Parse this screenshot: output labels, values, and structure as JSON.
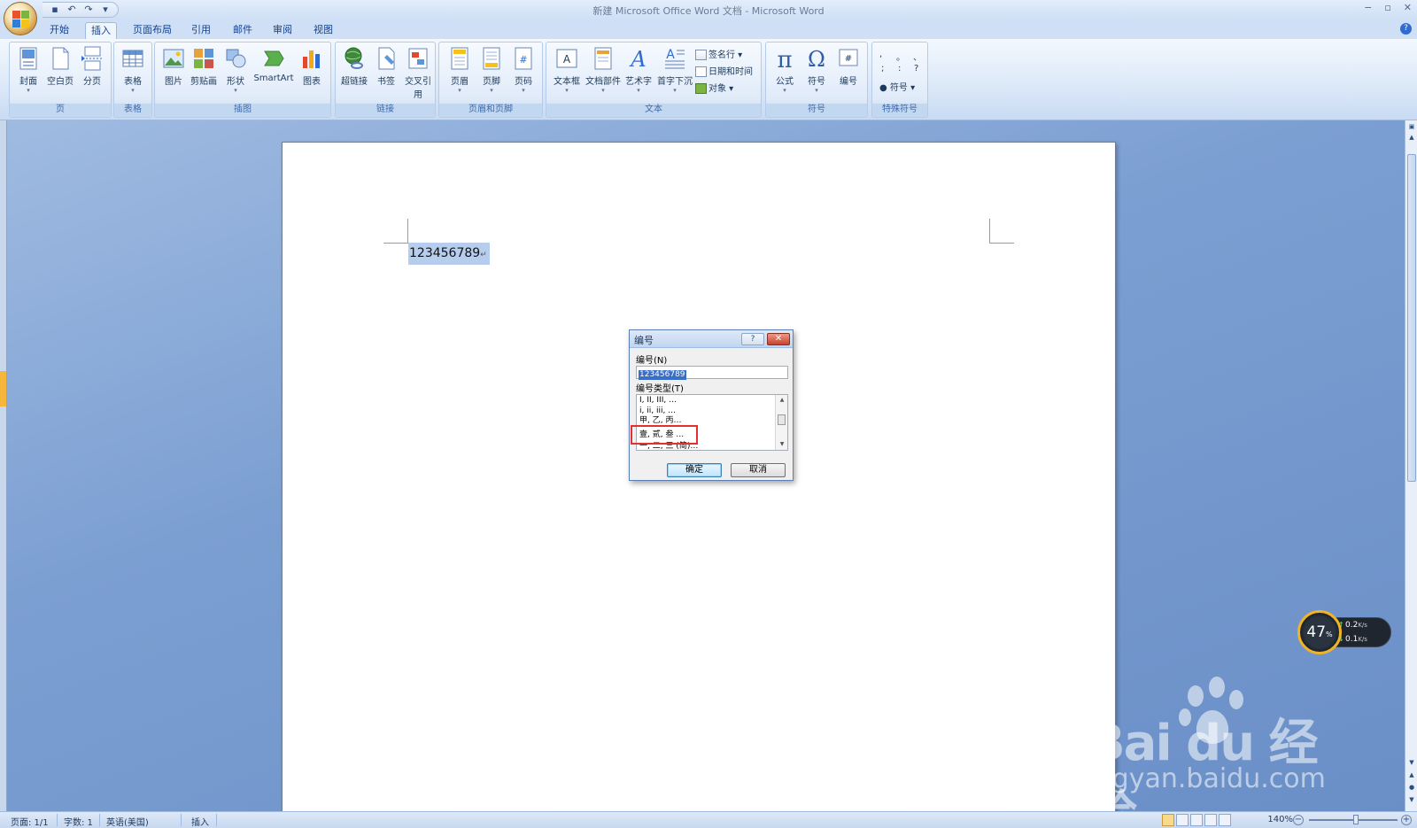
{
  "window": {
    "title": "新建 Microsoft Office Word 文档 - Microsoft Word",
    "controls": [
      "−",
      "▫",
      "✕"
    ]
  },
  "qat": {
    "save_icon": "save-icon",
    "undo_icon": "undo-icon",
    "redo_icon": "redo-icon"
  },
  "tabs": [
    "开始",
    "插入",
    "页面布局",
    "引用",
    "邮件",
    "审阅",
    "视图"
  ],
  "active_tab": "插入",
  "ribbon": {
    "groups": {
      "page": {
        "label": "页",
        "buttons": [
          "封面",
          "空白页",
          "分页"
        ]
      },
      "table": {
        "label": "表格",
        "buttons": [
          "表格"
        ]
      },
      "illustrations": {
        "label": "插图",
        "buttons": [
          "图片",
          "剪贴画",
          "形状",
          "SmartArt",
          "图表"
        ]
      },
      "links": {
        "label": "链接",
        "buttons": [
          "超链接",
          "书签",
          "交叉引用"
        ]
      },
      "header_footer": {
        "label": "页眉和页脚",
        "buttons": [
          "页眉",
          "页脚",
          "页码"
        ]
      },
      "text": {
        "label": "文本",
        "buttons": [
          "文本框",
          "文档部件",
          "艺术字",
          "首字下沉"
        ],
        "small": [
          "签名行",
          "日期和时间",
          "对象"
        ]
      },
      "symbols": {
        "label": "符号",
        "buttons": [
          "公式",
          "符号",
          "编号"
        ]
      },
      "special": {
        "label": "特殊符号",
        "chars": [
          ",",
          "。",
          "、",
          ";",
          ":",
          "?"
        ],
        "button": "符号"
      }
    }
  },
  "document": {
    "selected_text": "123456789"
  },
  "dialog": {
    "title": "编号",
    "help": "?",
    "close": "✕",
    "number_label": "编号(N)",
    "number_value": "123456789",
    "type_label": "编号类型(T)",
    "list": [
      "I, II, III, …",
      "i, ii, iii, …",
      "甲, 乙, 丙…",
      "壹, 贰, 叁 …",
      "一, 二, 三 (简)…"
    ],
    "ok": "确定",
    "cancel": "取消"
  },
  "statusbar": {
    "page": "页面: 1/1",
    "words": "字数: 1",
    "language": "英语(美国)",
    "mode": "插入",
    "zoom": "140%"
  },
  "net_widget": {
    "cpu": "47",
    "unit": "%",
    "up": "0.2",
    "down": "0.1",
    "rate_unit": "K/s"
  },
  "watermark": {
    "brand": "Bai du 经验",
    "site": "jingyan.baidu.com"
  },
  "colors": {
    "accent": "#15428b",
    "selection": "#b6cdee",
    "highlight_box": "#e5312e"
  }
}
